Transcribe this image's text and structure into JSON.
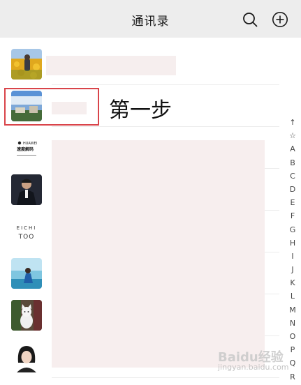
{
  "header": {
    "title": "通讯录",
    "search_icon": "search-icon",
    "add_icon": "add-circle-icon"
  },
  "contacts": [
    {
      "avatar": "sunflower-field-photo"
    },
    {
      "avatar": "blue-sky-photo"
    },
    {
      "avatar": "huawei-logo",
      "logo_brand": "HUAWEI",
      "logo_line1": "速度解码"
    },
    {
      "avatar": "man-portrait-photo"
    },
    {
      "avatar": "eichi-too-logo",
      "logo_line1": "EICHI",
      "logo_line2": "TOO"
    },
    {
      "avatar": "seaside-girl-photo"
    },
    {
      "avatar": "cat-photo"
    },
    {
      "avatar": "woman-portrait-photo"
    }
  ],
  "annotation": {
    "step_label": "第一步",
    "highlight_color": "#d9444a"
  },
  "index_bar": [
    "↑",
    "☆",
    "A",
    "B",
    "C",
    "D",
    "E",
    "F",
    "G",
    "H",
    "I",
    "J",
    "K",
    "L",
    "M",
    "N",
    "O",
    "P",
    "Q",
    "R"
  ],
  "watermark": {
    "text": "Baidu经验",
    "subtext": "jingyan.baidu.com"
  }
}
